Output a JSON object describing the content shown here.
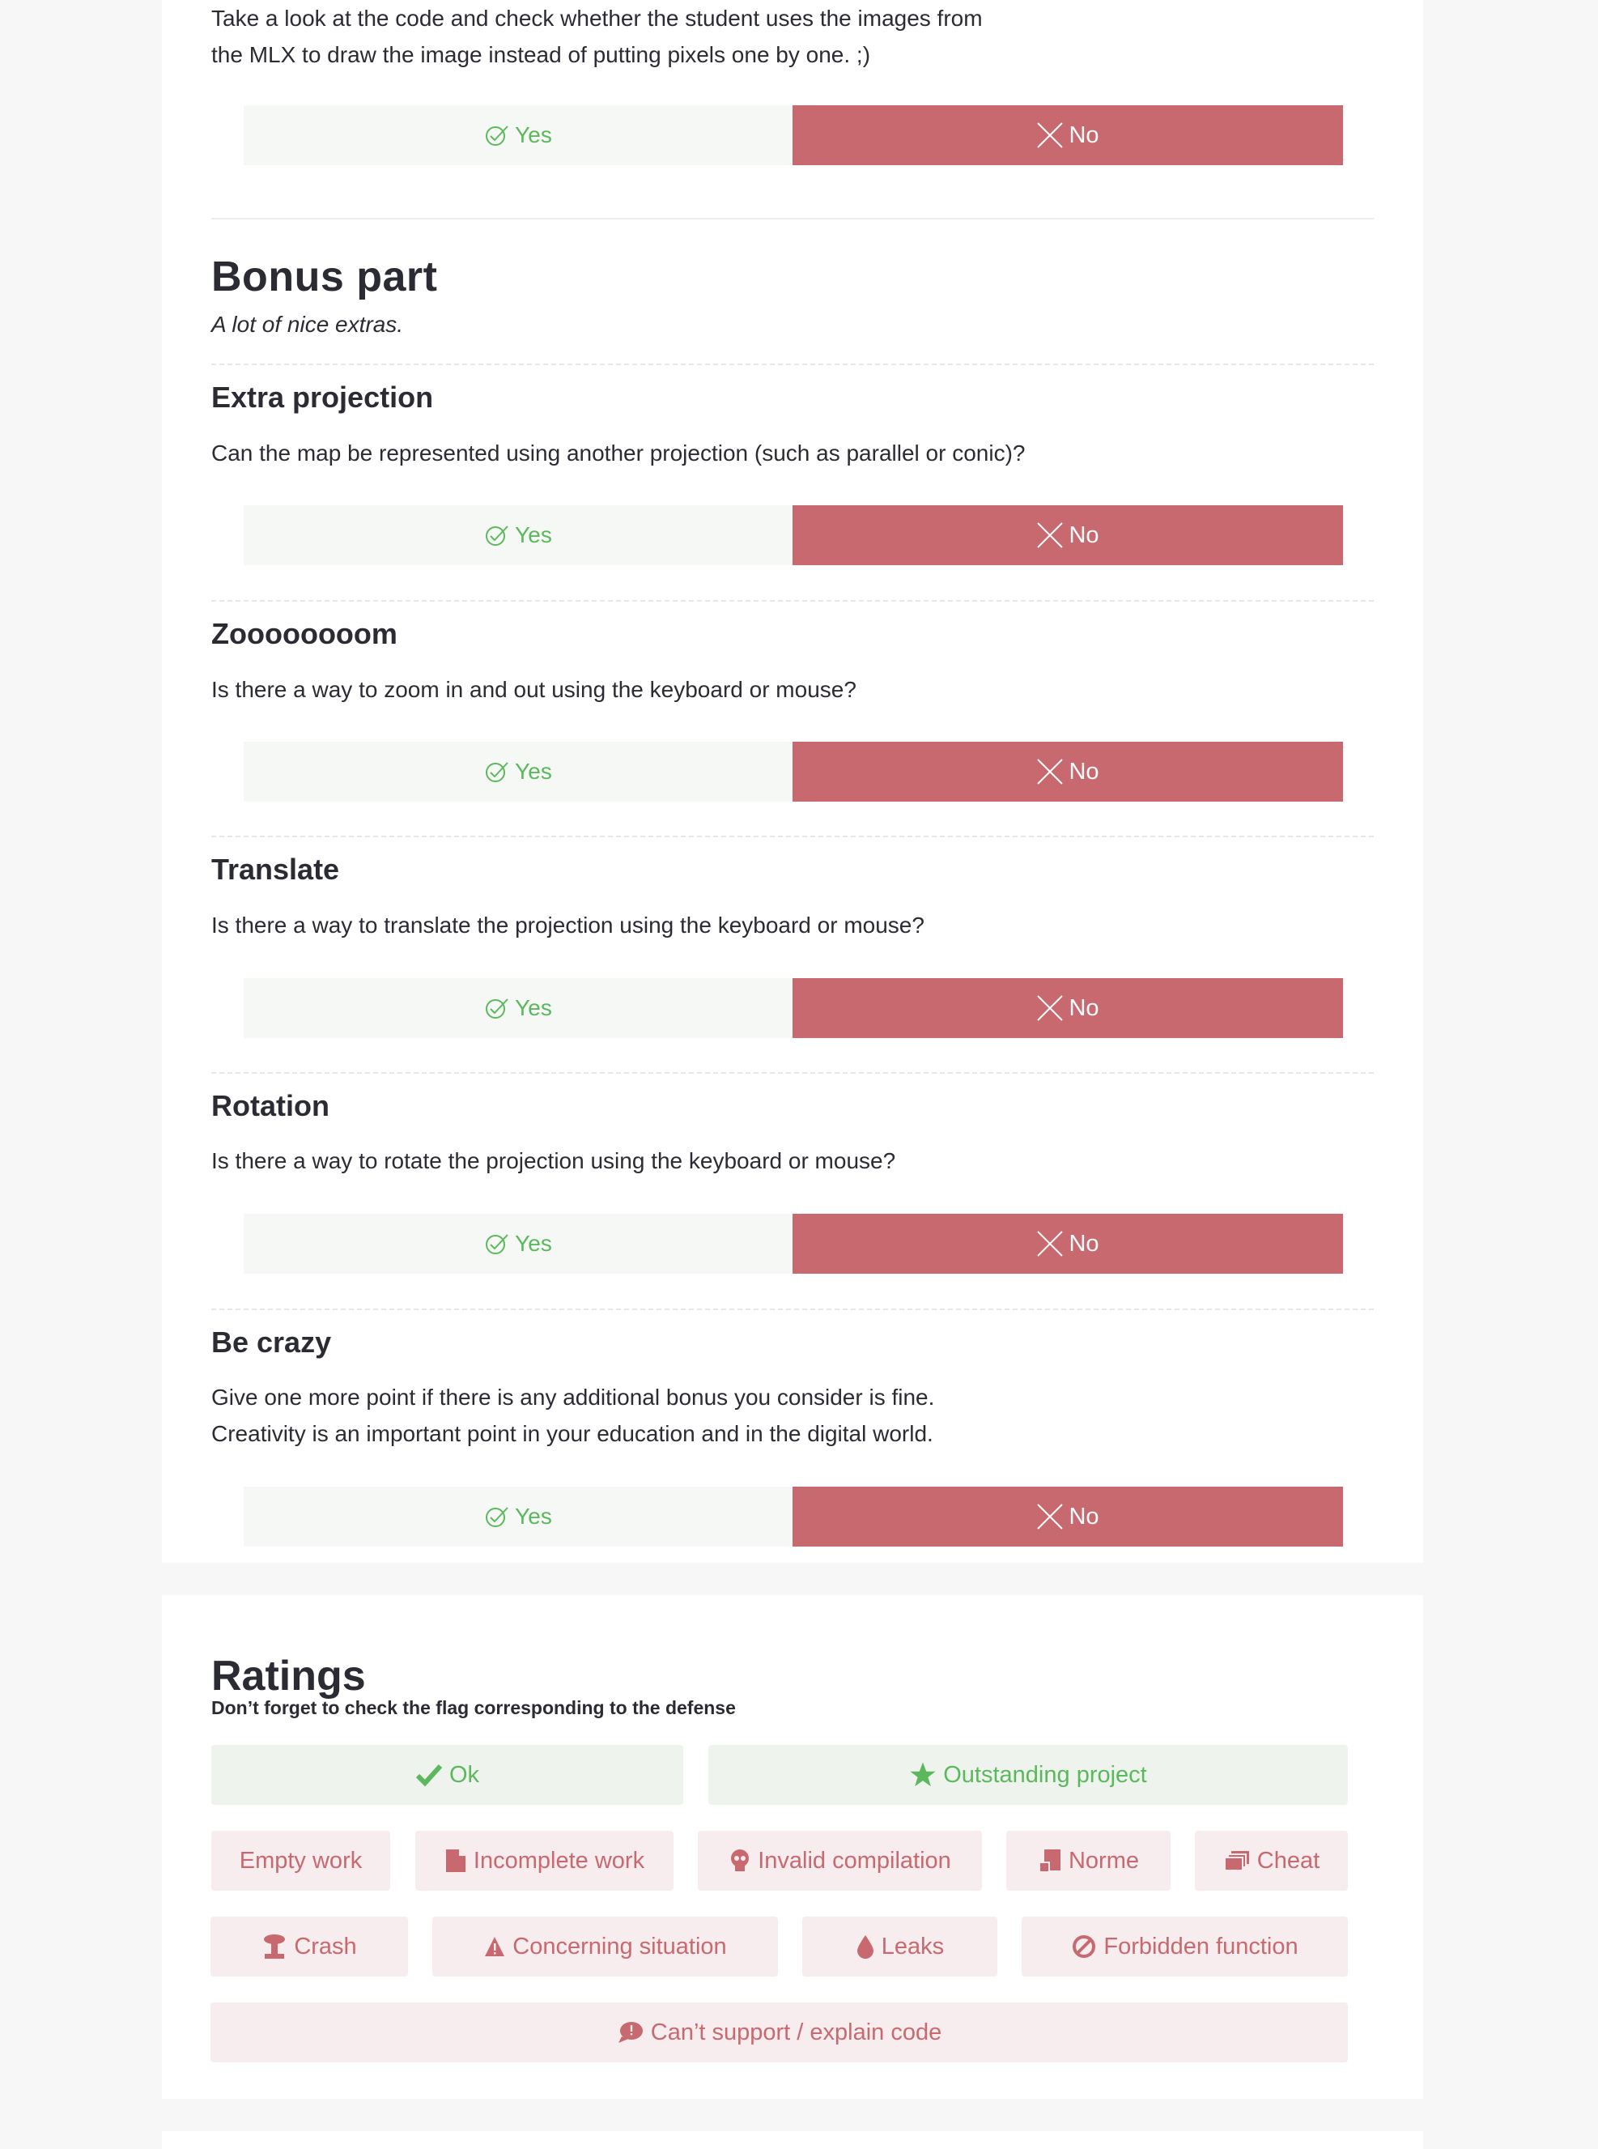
{
  "colors": {
    "yes": "#5cb85c",
    "no_bg": "#c8696f",
    "bad_text": "#c8696f",
    "good_bg": "#eef4ed",
    "bad_bg": "#f7ecee"
  },
  "top_question": {
    "description": "Take a look at the code and check whether the student uses the images from\nthe MLX to draw the image instead of putting pixels one by one. ;)",
    "yes_label": "Yes",
    "no_label": "No"
  },
  "bonus": {
    "title": "Bonus part",
    "subtitle": "A lot of nice extras.",
    "questions": [
      {
        "title": "Extra projection",
        "description": "Can the map be represented using another projection (such as parallel or conic)?",
        "yes_label": "Yes",
        "no_label": "No"
      },
      {
        "title": "Zoooooooom",
        "description": "Is there a way to zoom in and out using the keyboard or mouse?",
        "yes_label": "Yes",
        "no_label": "No"
      },
      {
        "title": "Translate",
        "description": "Is there a way to translate the projection using the keyboard or mouse?",
        "yes_label": "Yes",
        "no_label": "No"
      },
      {
        "title": "Rotation",
        "description": "Is there a way to rotate the projection using the keyboard or mouse?",
        "yes_label": "Yes",
        "no_label": "No"
      },
      {
        "title": "Be crazy",
        "description": "Give one more point if there is any additional bonus you consider is fine.\nCreativity is an important point in your education and in the digital world.",
        "yes_label": "Yes",
        "no_label": "No"
      }
    ]
  },
  "ratings": {
    "title": "Ratings",
    "note": "Don’t forget to check the flag corresponding to the defense",
    "flags": {
      "ok": {
        "label": "Ok",
        "icon": "check-icon"
      },
      "outstanding": {
        "label": "Outstanding project",
        "icon": "star-icon"
      },
      "empty": {
        "label": "Empty work",
        "icon": ""
      },
      "incomplete": {
        "label": "Incomplete work",
        "icon": "document-icon"
      },
      "invalid_compilation": {
        "label": "Invalid compilation",
        "icon": "skull-icon"
      },
      "norme": {
        "label": "Norme",
        "icon": "norme-icon"
      },
      "cheat": {
        "label": "Cheat",
        "icon": "copy-icon"
      },
      "crash": {
        "label": "Crash",
        "icon": "explosion-icon"
      },
      "concerning": {
        "label": "Concerning situation",
        "icon": "warning-icon"
      },
      "leaks": {
        "label": "Leaks",
        "icon": "drop-icon"
      },
      "forbidden": {
        "label": "Forbidden function",
        "icon": "ban-icon"
      },
      "cant_explain": {
        "label": "Can’t support / explain code",
        "icon": "speech-bubble-icon"
      }
    }
  }
}
